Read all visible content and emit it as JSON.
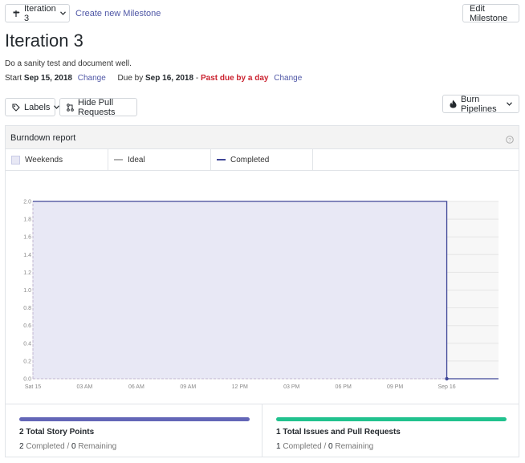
{
  "header": {
    "milestone_select_label": "Iteration 3",
    "create_link": "Create new Milestone",
    "edit_button": "Edit Milestone"
  },
  "milestone": {
    "title": "Iteration 3",
    "description": "Do a sanity test and document well.",
    "start_prefix": "Start",
    "start_date": "Sep 15, 2018",
    "change_start": "Change",
    "due_prefix": "Due by",
    "due_date": "Sep 16, 2018",
    "due_sep": "-",
    "past_due": "Past due by a day",
    "change_due": "Change"
  },
  "toolbar": {
    "labels_button": "Labels",
    "hide_pr_button": "Hide Pull Requests",
    "burn_button": "Burn Pipelines"
  },
  "report": {
    "title": "Burndown report",
    "legend": {
      "weekends": "Weekends",
      "ideal": "Ideal",
      "completed": "Completed"
    }
  },
  "colors": {
    "accent": "#4f57a6",
    "completed_line": "#3f4697",
    "area_fill": "#e8e8f5",
    "ideal_line": "#b0b0b0",
    "story_bar": "#6366b7",
    "issues_bar": "#21c28e",
    "past_due": "#cb2431"
  },
  "chart_data": {
    "type": "line",
    "x_ticks": [
      "Sat 15",
      "03 AM",
      "06 AM",
      "09 AM",
      "12 PM",
      "03 PM",
      "06 PM",
      "09 PM",
      "Sep 16"
    ],
    "y_ticks": [
      "0.0",
      "0.2",
      "0.4",
      "0.6",
      "0.8",
      "1.0",
      "1.2",
      "1.4",
      "1.6",
      "1.8",
      "2.0"
    ],
    "ylim": [
      0,
      2
    ],
    "grid": true,
    "series": [
      {
        "name": "Ideal",
        "points": [
          [
            0,
            0
          ],
          [
            27,
            0
          ]
        ]
      },
      {
        "name": "Completed",
        "points": [
          [
            0,
            2
          ],
          [
            24,
            2
          ],
          [
            24,
            0
          ],
          [
            27,
            0
          ]
        ]
      }
    ]
  },
  "stats": {
    "story_points": {
      "title": "2 Total Story Points",
      "completed_count": "2",
      "completed_label": "Completed",
      "separator": "/",
      "remaining_count": "0",
      "remaining_label": "Remaining"
    },
    "issues": {
      "title": "1 Total Issues and Pull Requests",
      "completed_count": "1",
      "completed_label": "Completed",
      "separator": "/",
      "remaining_count": "0",
      "remaining_label": "Remaining"
    }
  }
}
